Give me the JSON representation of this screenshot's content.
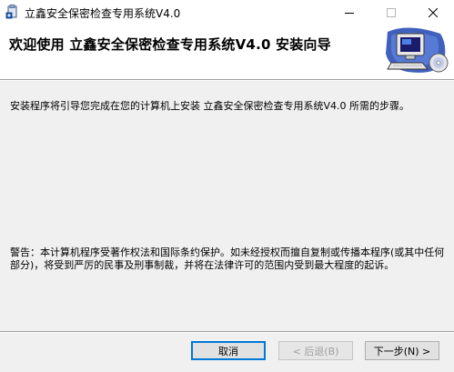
{
  "window": {
    "title": "立鑫安全保密检查专用系统V4.0"
  },
  "header": {
    "title": "欢迎使用 立鑫安全保密检查专用系统V4.0 安装向导",
    "art_icon": "computer-with-disc-icon"
  },
  "content": {
    "intro": "安装程序将引导您完成在您的计算机上安装 立鑫安全保密检查专用系统V4.0 所需的步骤。",
    "warning": "警告：本计算机程序受著作权法和国际条约保护。如未经授权而擅自复制或传播本程序(或其中任何部分)，将受到严厉的民事及刑事制裁，并将在法律许可的范围内受到最大程度的起诉。"
  },
  "buttons": {
    "cancel": "取消",
    "back": "< 后退(B)",
    "next": "下一步(N) >"
  },
  "colors": {
    "accent": "#0078d7",
    "dialog_bg": "#f0f0f0",
    "header_bg": "#ffffff"
  }
}
